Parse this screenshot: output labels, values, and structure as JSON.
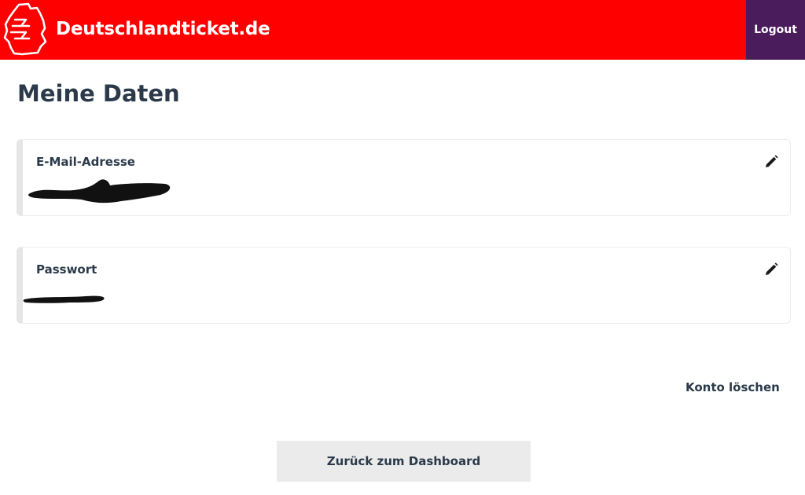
{
  "header": {
    "brand": "Deutschlandticket.de",
    "logout_label": "Logout",
    "background_color": "#ff0000",
    "logout_color": "#4a1c5c"
  },
  "main": {
    "title": "Meine Daten",
    "fields": [
      {
        "label": "E-Mail-Adresse",
        "value_state": "redacted",
        "edit_icon": "pencil-icon"
      },
      {
        "label": "Passwort",
        "value_state": "redacted",
        "edit_icon": "pencil-icon"
      }
    ],
    "delete_account_label": "Konto löschen",
    "back_button_label": "Zurück zum Dashboard"
  }
}
